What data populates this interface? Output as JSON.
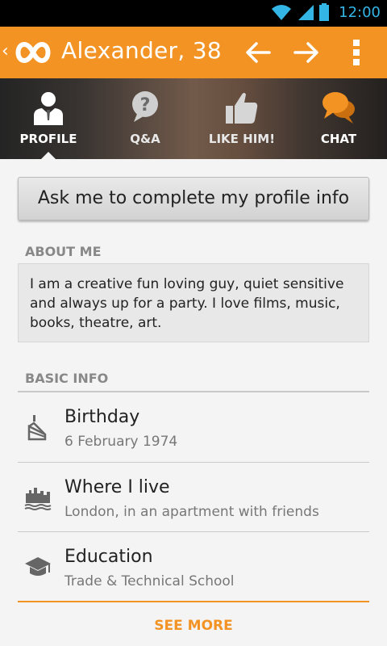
{
  "status_bar": {
    "time": "12:00"
  },
  "action_bar": {
    "back_glyph": "‹",
    "title": "Alexander, 38",
    "accent_color": "#f39324"
  },
  "tabs": [
    {
      "label": "PROFILE",
      "icon": "profile-icon",
      "selected": true
    },
    {
      "label": "Q&A",
      "icon": "question-icon",
      "selected": false
    },
    {
      "label": "LIKE HIM!",
      "icon": "thumbs-up-icon",
      "selected": false
    },
    {
      "label": "CHAT",
      "icon": "chat-bubbles-icon",
      "selected": false
    }
  ],
  "ask_button": {
    "label": "Ask me to complete my profile info"
  },
  "about": {
    "heading": "ABOUT ME",
    "text": "I am a creative fun loving guy, quiet sensitive and always up for a party. I love films, music, books, theatre, art."
  },
  "basic_info": {
    "heading": "BASIC INFO",
    "rows": [
      {
        "title": "Birthday",
        "value": "6 February 1974",
        "icon": "cake-icon"
      },
      {
        "title": "Where I live",
        "value": "London, in an apartment with friends",
        "icon": "city-icon"
      },
      {
        "title": "Education",
        "value": "Trade & Technical School",
        "icon": "graduation-cap-icon"
      }
    ]
  },
  "see_more": {
    "label": "SEE MORE"
  }
}
